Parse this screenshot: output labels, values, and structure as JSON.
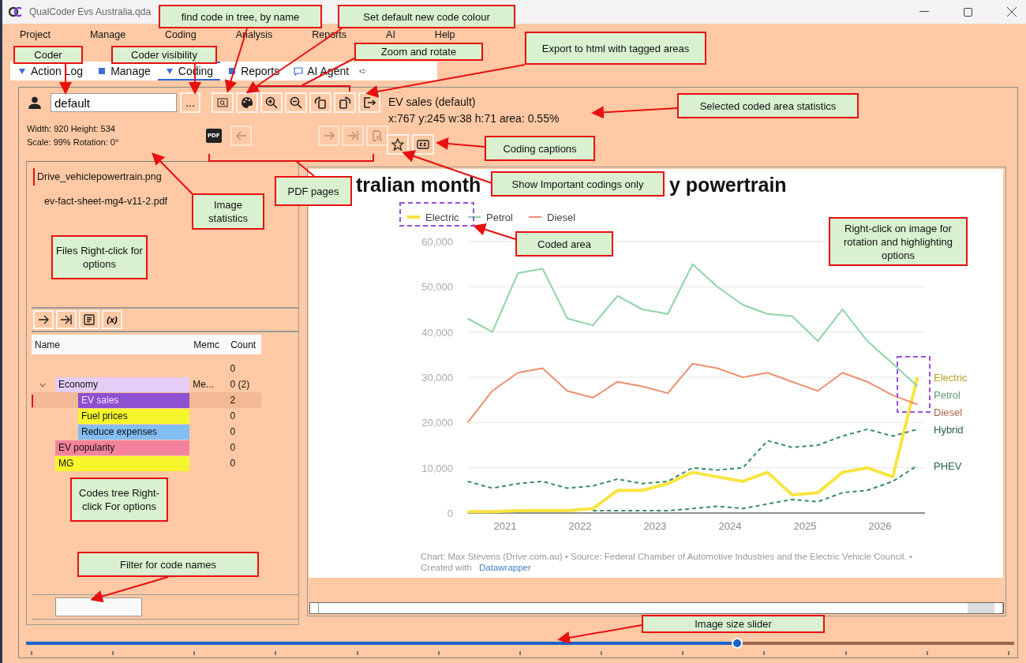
{
  "window": {
    "title": "QualCoder Evs Australia.qda"
  },
  "menu": [
    "Project",
    "Manage",
    "Coding",
    "Analysis",
    "Reports",
    "AI",
    "Help"
  ],
  "tabs": [
    {
      "label": "Action Log",
      "selected": false
    },
    {
      "label": "Manage",
      "selected": false
    },
    {
      "label": "Coding",
      "selected": true
    },
    {
      "label": "Reports",
      "selected": false
    },
    {
      "label": "AI Agent",
      "selected": false
    }
  ],
  "tab_scroll": "➪",
  "coder": {
    "value": "default",
    "more_button": "..."
  },
  "selection": {
    "code": "EV sales (default)",
    "stats": "x:767 y:245 w:38 h:71 area: 0.55%"
  },
  "image_stats": [
    "Width: 920 Height: 534",
    "Scale: 99% Rotation: 0°"
  ],
  "pdf_badge": "PDF",
  "files": [
    {
      "name": "Drive_vehiclepowertrain.png",
      "selected": true
    },
    {
      "name": "ev-fact-sheet-mg4-v11-2.pdf",
      "selected": false
    }
  ],
  "tree_memo_button": "(x)",
  "code_tree": {
    "columns": [
      "Name",
      "Memc",
      "Count"
    ],
    "items": [
      {
        "count": "0"
      },
      {
        "name": "Economy",
        "memo": "Me...",
        "count": "0 (2)",
        "color": "#e4cef6",
        "expanded": true,
        "selected": false,
        "children": [
          {
            "name": "EV sales",
            "count": "2",
            "color": "#8e4fd0",
            "selected": true
          },
          {
            "name": "Fuel prices",
            "count": "0",
            "color": "#f6f62c",
            "selected": false
          },
          {
            "name": "Reduce expenses",
            "count": "0",
            "color": "#82bdf3",
            "selected": false
          }
        ]
      },
      {
        "name": "EV popularity",
        "count": "0",
        "color": "#f5829c",
        "selected": false
      },
      {
        "name": "MG",
        "count": "0",
        "color": "#f6f62c",
        "selected": false
      }
    ]
  },
  "viewer": {
    "title_parts": [
      "tralian month",
      "y powertrain"
    ],
    "chart_data": {
      "type": "line",
      "x": [
        2020.5,
        2020.83,
        2021.17,
        2021.5,
        2021.83,
        2022.17,
        2022.5,
        2022.83,
        2023.17,
        2023.5,
        2023.83,
        2024.17,
        2024.5,
        2024.83,
        2025.17,
        2025.5,
        2025.83,
        2026.17,
        2026.5
      ],
      "series": [
        {
          "name": "Electric",
          "color": "#f8e440",
          "line_style": "solid",
          "values": [
            300,
            300,
            500,
            500,
            500,
            1000,
            5000,
            5000,
            6500,
            9000,
            8000,
            7000,
            9000,
            4000,
            4500,
            9000,
            10000,
            8000,
            30000
          ]
        },
        {
          "name": "Petrol",
          "color": "#8fd3a6",
          "line_style": "solid",
          "values": [
            43000,
            40000,
            53000,
            54000,
            43000,
            41500,
            48000,
            45000,
            44000,
            55000,
            50000,
            46000,
            44000,
            43500,
            38000,
            45000,
            38000,
            33000,
            28000
          ]
        },
        {
          "name": "Diesel",
          "color": "#ee8f70",
          "line_style": "solid",
          "values": [
            20000,
            27000,
            31000,
            32000,
            27000,
            25500,
            29000,
            28000,
            26500,
            33000,
            32000,
            30000,
            31000,
            29000,
            27000,
            31000,
            29000,
            26000,
            24000
          ]
        },
        {
          "name": "Hybrid",
          "color": "#3a8a62",
          "line_style": "dashed",
          "values": [
            7000,
            5500,
            6500,
            7000,
            5500,
            6000,
            7500,
            6500,
            7000,
            10000,
            9500,
            10000,
            16000,
            14500,
            15000,
            17000,
            18500,
            17000,
            18500
          ]
        },
        {
          "name": "PHEV",
          "color": "#3a8a62",
          "line_style": "dashed",
          "values": [
            null,
            null,
            null,
            null,
            null,
            500,
            500,
            500,
            500,
            1000,
            1500,
            1000,
            2000,
            3000,
            2500,
            4500,
            5000,
            7000,
            10500
          ]
        }
      ],
      "xlim": [
        2020.5,
        2026.6
      ],
      "xticks": [
        2021,
        2022,
        2023,
        2024,
        2025,
        2026
      ],
      "yticks": [
        {
          "value": 0,
          "label": "0"
        },
        {
          "value": 10000,
          "label": "10,000"
        },
        {
          "value": 20000,
          "label": "20,000"
        },
        {
          "value": 30000,
          "label": "30,000"
        },
        {
          "value": 40000,
          "label": "40,000"
        },
        {
          "value": 50000,
          "label": "50,000"
        },
        {
          "value": 60000,
          "label": "60,000"
        }
      ],
      "ylim": [
        0,
        60000
      ],
      "grid": true,
      "legend": [
        {
          "name": "Electric",
          "color": "#f8e440"
        },
        {
          "name": "Petrol",
          "color": "#8fd3a6"
        },
        {
          "name": "Diesel",
          "color": "#ee8f70"
        }
      ]
    },
    "source_note": "Chart: Max Stevens (Drive.com.au) • Source: Federal Chamber of Automotive Industries and the Electric Vehicle Council.  •",
    "created_with": "Created with",
    "link": "Datawrapper"
  },
  "slider": {
    "level": 0.72
  },
  "callouts": [
    "find code in tree, by name",
    "Set default new code colour",
    "Coder",
    "Coder visibility",
    "Zoom and rotate",
    "Export to html with tagged areas",
    "Selected coded area statistics",
    "Coding captions",
    "Show Important codings only",
    "Image statistics",
    "PDF pages",
    "Coded area",
    "Files Right-click for options",
    "Right-click on image for rotation and highlighting  options",
    "Codes tree Right-click For options",
    "Filter for code names",
    "Image size slider"
  ]
}
